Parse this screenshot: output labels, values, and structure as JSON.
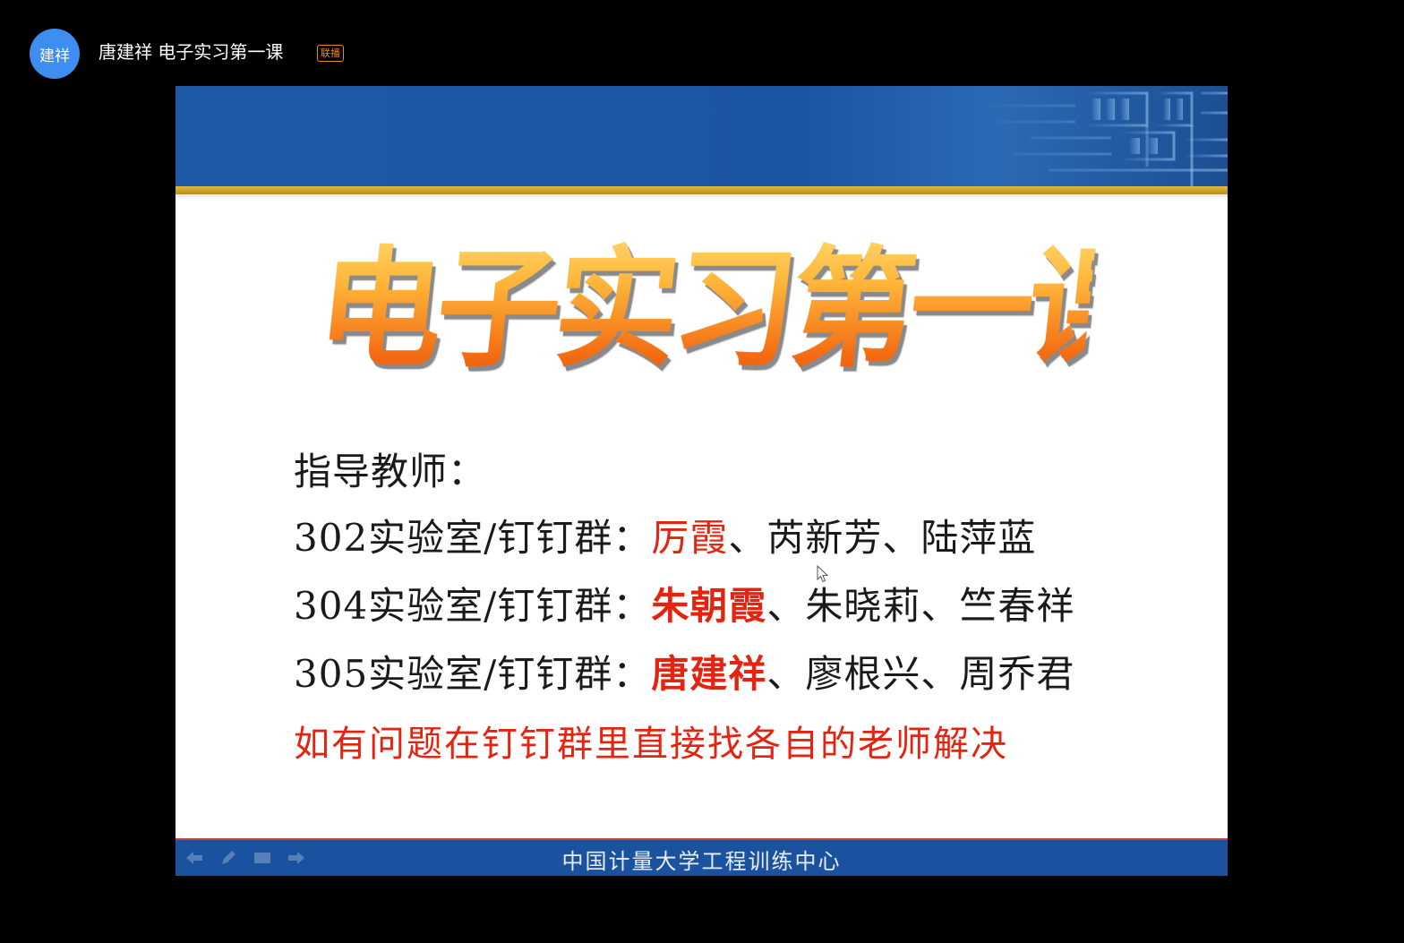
{
  "header": {
    "avatar_text": "建祥",
    "title": "唐建祥 电子实习第一课",
    "badge": "联播"
  },
  "slide": {
    "title": "电子实习第一课",
    "heading": "指导教师：",
    "rows": [
      {
        "prefix": "302实验室/钉钉群：",
        "highlight": "厉霞",
        "rest": "、芮新芳、陆萍蓝"
      },
      {
        "prefix": "304实验室/钉钉群：",
        "highlight": "朱朝霞",
        "rest": "、朱晓莉、竺春祥"
      },
      {
        "prefix": "305实验室/钉钉群：",
        "highlight": "唐建祥",
        "rest": "、廖根兴、周乔君"
      }
    ],
    "note": "如有问题在钉钉群里直接找各自的老师解决",
    "footer": "中国计量大学工程训练中心"
  },
  "icons": {
    "nav_prev": "arrow-left-icon",
    "nav_pen": "pen-icon",
    "nav_menu": "menu-icon",
    "nav_next": "arrow-right-icon",
    "cursor": "mouse-cursor-icon"
  },
  "colors": {
    "background": "#000000",
    "avatar": "#3d8ef0",
    "badge": "#e88a1a",
    "slide_blue": "#1b56a2",
    "gold": "#d4a82c",
    "highlight_red": "#e32410"
  }
}
